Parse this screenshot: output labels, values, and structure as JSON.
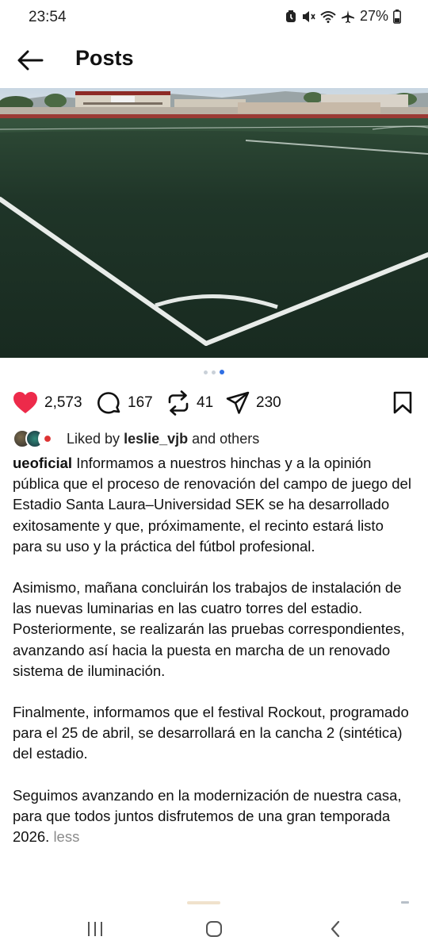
{
  "status_bar": {
    "time": "23:54",
    "battery": "27%",
    "icons": [
      "alarm-icon",
      "mute-icon",
      "wifi-icon",
      "airplane-icon",
      "battery-icon"
    ]
  },
  "header": {
    "title": "Posts",
    "back_icon": "arrow-left-icon"
  },
  "carousel": {
    "count": 3,
    "active_index": 2,
    "image_description_icon": "football-pitch-corner-photo"
  },
  "actions": {
    "likes": "2,573",
    "comments": "167",
    "reposts": "41",
    "shares": "230",
    "like_color": "#ed2a4a"
  },
  "liked_by": {
    "prefix": "Liked by",
    "user": "leslie_vjb",
    "suffix": "and others"
  },
  "caption": {
    "username": "ueoficial",
    "paragraph_1": "Informamos a nuestros hinchas y a la opinión pública que el proceso de renovación del campo de juego del Estadio Santa Laura–Universidad SEK se ha desarrollado exitosamente y que, próximamente, el recinto estará listo para su uso y la práctica del fútbol profesional.",
    "paragraph_2": "Asimismo, mañana concluirán los trabajos de instalación de las nuevas luminarias en las cuatro torres del estadio. Posteriormente, se realizarán las pruebas correspondientes, avanzando así hacia la puesta en marcha de un renovado sistema de iluminación.",
    "paragraph_3": "Finalmente, informamos que el festival Rockout, programado para el 25 de abril, se desarrollará en la cancha 2 (sintética) del estadio.",
    "paragraph_4": "Seguimos avanzando en la modernización de nuestra casa, para que todos juntos disfrutemos de una gran temporada 2026.",
    "less_label": "less"
  },
  "nav_bar": {
    "icons": [
      "recent-apps-icon",
      "home-icon",
      "back-icon"
    ]
  }
}
